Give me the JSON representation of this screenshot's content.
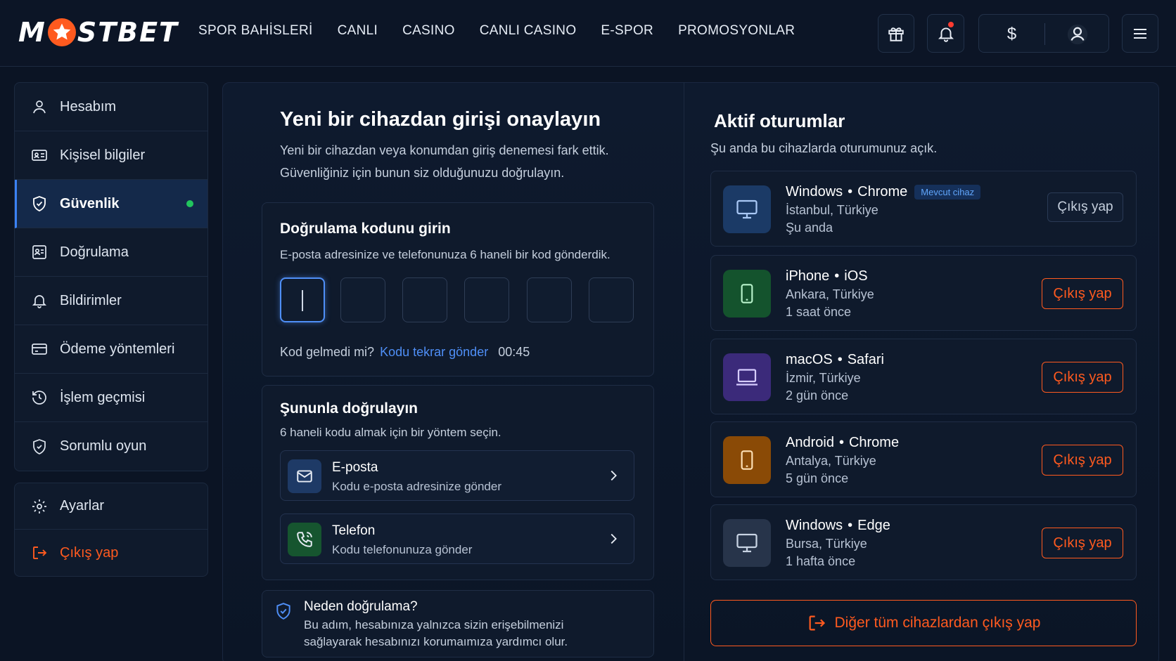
{
  "brand": {
    "logo_text_left": "M",
    "logo_text_right": "STBET",
    "accent": "#ff5a1f"
  },
  "nav": [
    "SPOR BAHİSLERİ",
    "CANLI",
    "CASINO",
    "CANLI CASINO",
    "E-SPOR",
    "PROMOSYONLAR"
  ],
  "header_icons": {
    "gift": "gift-icon",
    "bell": "bell-icon",
    "currency": "$",
    "profile": "user-icon",
    "menu": "menu-icon"
  },
  "sidebar": {
    "group1": [
      {
        "label": "Hesabım",
        "icon": "user-icon"
      },
      {
        "label": "Kişisel bilgiler",
        "icon": "id-card-icon"
      },
      {
        "label": "Güvenlik",
        "icon": "shield-icon",
        "active": true
      },
      {
        "label": "Doğrulama",
        "icon": "id-badge-icon"
      },
      {
        "label": "Bildirimler",
        "icon": "bell-icon"
      },
      {
        "label": "Ödeme yöntemleri",
        "icon": "card-icon"
      },
      {
        "label": "İşlem geçmisi",
        "icon": "history-icon"
      },
      {
        "label": "Sorumlu oyun",
        "icon": "shield-check-icon"
      }
    ],
    "group2": [
      {
        "label": "Ayarlar",
        "icon": "gear-icon"
      },
      {
        "label": "Çıkış yap",
        "icon": "logout-icon"
      }
    ]
  },
  "verify": {
    "title": "Yeni bir cihazdan girişi onaylayın",
    "desc_line1": "Yeni bir cihazdan veya konumdan giriş denemesi fark ettik.",
    "desc_line2": "Güvenliğiniz için bunun siz olduğunuzu doğrulayın.",
    "code_card": {
      "title": "Doğrulama kodunu girin",
      "desc": "E-posta adresinize ve telefonunuza 6 haneli bir kod gönderdik.",
      "digits": [
        "",
        "",
        "",
        "",
        "",
        ""
      ],
      "no_code": "Kod gelmedi mi?",
      "resend": "Kodu tekrar gönder",
      "timer": "00:45"
    },
    "method_card": {
      "title": "Şununla doğrulayın",
      "desc": "6 haneli kodu almak için bir yöntem seçin.",
      "options": [
        {
          "title": "E-posta",
          "sub": "Kodu e-posta adresinize gönder"
        },
        {
          "title": "Telefon",
          "sub": "Kodu telefonunuza gönder"
        }
      ]
    },
    "why_card": {
      "title": "Neden doğrulama?",
      "line1": "Bu adım,  hesabınıza yalnızca sizin erişebilmenizi",
      "line2": "sağlayarak hesabınızı korumaımıza yardımcı olur."
    }
  },
  "sessions": {
    "title": "Aktif oturumlar",
    "desc": "Şu anda bu cihazlarda oturumunuz açık.",
    "items": [
      {
        "os": "Windows",
        "browser": "Chrome",
        "location": "İstanbul, Türkiye",
        "time": "Şu anda",
        "badge": "Mevcut cihaz",
        "action": "Çıkış yap",
        "color": "#1b3a66",
        "icon": "monitor-icon"
      },
      {
        "os": "iPhone",
        "browser": "iOS",
        "location": "Ankara, Türkiye",
        "time": "1 saat önce",
        "action": "Çıkış yap",
        "color": "#14532d",
        "icon": "phone-icon"
      },
      {
        "os": "macOS",
        "browser": "Safari",
        "location": "İzmir, Türkiye",
        "time": "2 gün önce",
        "action": "Çıkış yap",
        "color": "#3b2a7a",
        "icon": "laptop-icon"
      },
      {
        "os": "Android",
        "browser": "Chrome",
        "location": "Antalya, Türkiye",
        "time": "5 gün önce",
        "action": "Çıkış yap",
        "color": "#8a4a06",
        "icon": "phone-icon"
      },
      {
        "os": "Windows",
        "browser": "Edge",
        "location": "Bursa, Türkiye",
        "time": "1 hafta önce",
        "action": "Çıkış yap",
        "color": "#27344a",
        "icon": "monitor-icon"
      }
    ],
    "logout_all": "Diğer tüm cihazlardan çıkış yap"
  }
}
